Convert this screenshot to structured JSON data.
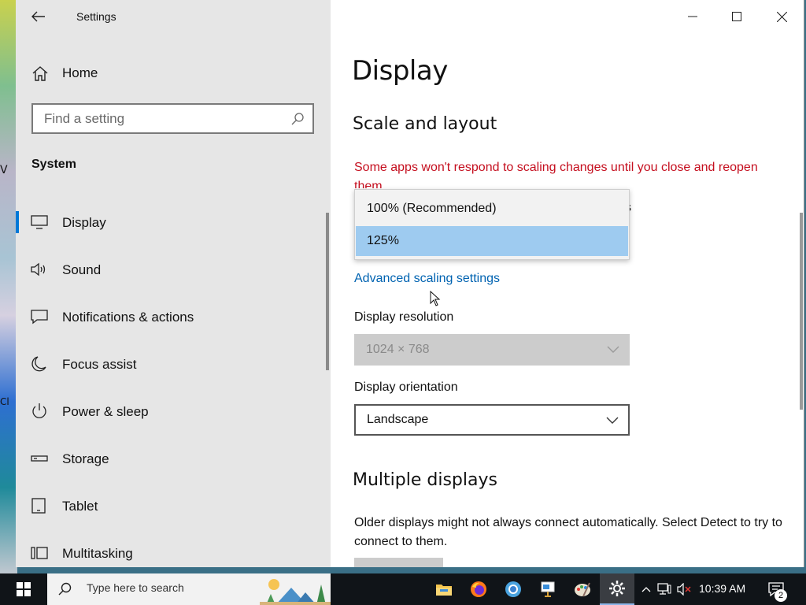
{
  "window": {
    "title": "Settings",
    "controls": [
      "minimize",
      "maximize",
      "close"
    ]
  },
  "nav": {
    "home_label": "Home",
    "search_placeholder": "Find a setting",
    "section_label": "System",
    "items": [
      {
        "label": "Display",
        "icon": "monitor-icon",
        "active": true
      },
      {
        "label": "Sound",
        "icon": "speaker-icon"
      },
      {
        "label": "Notifications & actions",
        "icon": "notification-icon"
      },
      {
        "label": "Focus assist",
        "icon": "moon-icon"
      },
      {
        "label": "Power & sleep",
        "icon": "power-icon"
      },
      {
        "label": "Storage",
        "icon": "storage-icon"
      },
      {
        "label": "Tablet",
        "icon": "tablet-icon"
      },
      {
        "label": "Multitasking",
        "icon": "multitasking-icon"
      }
    ]
  },
  "content": {
    "page_title": "Display",
    "scale_heading": "Scale and layout",
    "warning": "Some apps won't respond to scaling changes until you close and reopen them.",
    "scale_dropdown": {
      "options": [
        "100% (Recommended)",
        "125%"
      ],
      "highlighted": "125%"
    },
    "hidden_suffix": "s",
    "advanced_link": "Advanced scaling settings",
    "resolution_label": "Display resolution",
    "resolution_value": "1024 × 768",
    "orientation_label": "Display orientation",
    "orientation_value": "Landscape",
    "multiple_heading": "Multiple displays",
    "multiple_text": "Older displays might not always connect automatically. Select Detect to try to connect to them."
  },
  "taskbar": {
    "search_placeholder": "Type here to search",
    "apps": [
      "file-explorer-icon",
      "firefox-icon",
      "chrome-icon",
      "presentation-icon",
      "paint-icon",
      "settings-gear-icon"
    ],
    "time": "10:39 AM",
    "notification_count": "2"
  },
  "desktop": {
    "edge_texts": [
      "V",
      "Cl"
    ]
  },
  "colors": {
    "accent": "#0078d7",
    "link": "#0063b1",
    "warning": "#c50f1f",
    "selected_option": "#9ecbf0"
  }
}
